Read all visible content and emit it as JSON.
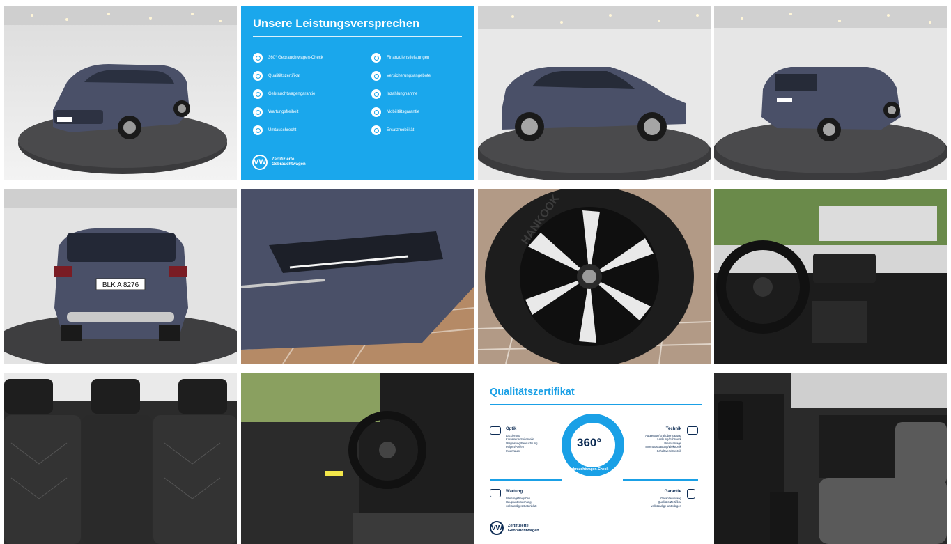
{
  "gallery": {
    "tiles": [
      {
        "name": "photo-front-left",
        "kind": "photo"
      },
      {
        "name": "leistungsversprechen-card",
        "kind": "card"
      },
      {
        "name": "photo-side",
        "kind": "photo"
      },
      {
        "name": "photo-rear-right",
        "kind": "photo"
      },
      {
        "name": "photo-rear",
        "kind": "photo"
      },
      {
        "name": "photo-headlight",
        "kind": "photo"
      },
      {
        "name": "photo-wheel",
        "kind": "photo"
      },
      {
        "name": "photo-cockpit",
        "kind": "photo"
      },
      {
        "name": "photo-rear-seats",
        "kind": "photo"
      },
      {
        "name": "photo-driver-door",
        "kind": "photo"
      },
      {
        "name": "qualitaetszertifikat-card",
        "kind": "card"
      },
      {
        "name": "photo-passenger-interior",
        "kind": "photo"
      }
    ]
  },
  "leistungsversprechen": {
    "title": "Unsere Leistungsversprechen",
    "left_items": [
      "360° Gebrauchtwagen-Check",
      "Qualitätszertifikat",
      "Gebrauchtwagengarantie",
      "Wartungsfreiheit",
      "Umtauschrecht"
    ],
    "right_items": [
      "Finanzdienstleistungen",
      "Versicherungsangebote",
      "Inzahlungnahme",
      "Mobilitätsgarantie",
      "Ersatzmobilität"
    ],
    "brand_line1": "Zertifizierte",
    "brand_line2": "Gebrauchtwagen",
    "brand_logo": "VW"
  },
  "rear_plate": "BLK A 8276",
  "wheel_tire_text": "HANKOOK",
  "qualitaet": {
    "title": "Qualitätszertifikat",
    "ring_value": "360°",
    "ring_caption": "Gebrauchtwagen-Check",
    "optik": {
      "heading": "Optik",
      "items": [
        "Lackierung",
        "Karosserie Seitenteile",
        "Verglasung/Beleuchtung",
        "Felgen/Reifen",
        "Innenraum"
      ]
    },
    "wartung": {
      "heading": "Wartung",
      "items": [
        "Wartungsfreigaben",
        "Hauptuntersuchung",
        "vollständiges Datenblatt"
      ]
    },
    "technik": {
      "heading": "Technik",
      "items": [
        "Aggregate/Kraftübertragung",
        "Lenkung/Fahrwerk",
        "Bremsanlage",
        "Innenausstattung/Elektronik",
        "Schaltwerk/Elektrik"
      ]
    },
    "garantie": {
      "heading": "Garantie",
      "items": [
        "Garantieumfang",
        "Qualitäts-Zertifikat",
        "vollständige Unterlagen"
      ]
    },
    "brand_line1": "Zertifizierte",
    "brand_line2": "Gebrauchtwagen",
    "brand_logo": "VW"
  },
  "colors": {
    "vw_blue": "#1aa7ec",
    "vw_navy": "#0d2c54",
    "car_paint": "#4a5068"
  }
}
